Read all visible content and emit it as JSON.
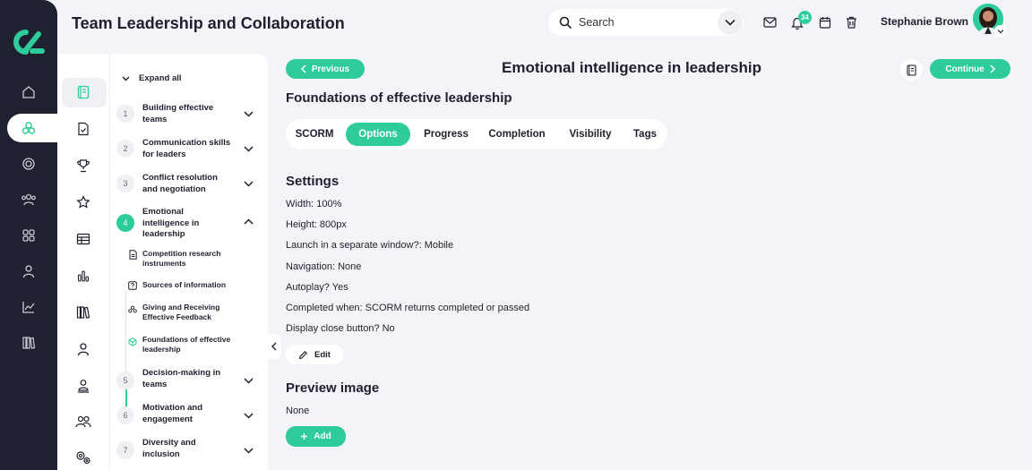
{
  "header": {
    "title": "Team Leadership and Collaboration",
    "search_placeholder": "Search",
    "notification_count": "34",
    "user_name": "Stephanie Brown"
  },
  "sidebar": {
    "items": [
      "home-icon",
      "courses-icon",
      "target-icon",
      "users-icon",
      "grid-icon",
      "user-icon",
      "chart-icon",
      "library-icon"
    ],
    "active_index": 1
  },
  "outline": {
    "expand_all": "Expand all",
    "modules": [
      {
        "num": "1",
        "title": "Building effective teams"
      },
      {
        "num": "2",
        "title": "Communication skills for leaders"
      },
      {
        "num": "3",
        "title": "Conflict resolution and negotiation"
      },
      {
        "num": "4",
        "title": "Emotional intelligence in leadership",
        "expanded": true
      },
      {
        "num": "5",
        "title": "Decision-making in teams"
      },
      {
        "num": "6",
        "title": "Motivation and engagement"
      },
      {
        "num": "7",
        "title": "Diversity and inclusion"
      }
    ],
    "units": [
      {
        "title": "Competition research instruments",
        "icon": "document-icon"
      },
      {
        "title": "Sources of information",
        "icon": "question-icon"
      },
      {
        "title": "Giving and Receiving Effective Feedback",
        "icon": "feedback-icon"
      },
      {
        "title": "Foundations of effective leadership",
        "icon": "scorm-icon",
        "active": true
      }
    ]
  },
  "content": {
    "previous_label": "Previous",
    "continue_label": "Continue",
    "module_title": "Emotional intelligence in leadership",
    "unit_title": "Foundations of effective leadership",
    "tabs": [
      "SCORM",
      "Options",
      "Progress",
      "Completion",
      "Visibility",
      "Tags"
    ],
    "active_tab": "Options",
    "settings_heading": "Settings",
    "settings": [
      "Width: 100%",
      "Height: 800px",
      "Launch in a separate window?: Mobile",
      "Navigation: None",
      "Autoplay? Yes",
      "Completed when: SCORM returns completed or passed",
      "Display close button? No"
    ],
    "edit_label": "Edit",
    "preview_heading": "Preview image",
    "preview_value": "None",
    "add_label": "Add"
  },
  "colors": {
    "accent": "#2ecc9a",
    "sidebar": "#1f2030",
    "background": "#f3f4f8"
  }
}
